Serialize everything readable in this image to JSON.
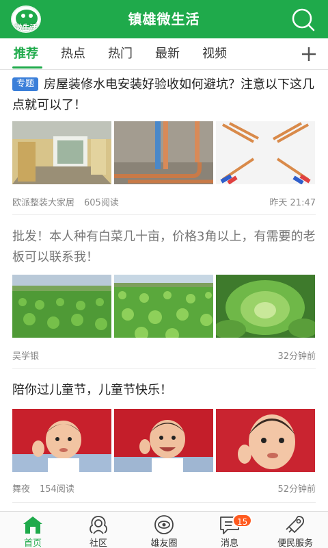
{
  "header": {
    "title": "镇雄微生活",
    "logo_text": "微生活",
    "accent": "#1faa4b"
  },
  "tabs": [
    {
      "label": "推荐",
      "active": true
    },
    {
      "label": "热点"
    },
    {
      "label": "热门"
    },
    {
      "label": "最新"
    },
    {
      "label": "视频"
    }
  ],
  "posts": [
    {
      "tag": "专题",
      "title": "房屋装修水电安装好验收如何避坑？注意以下这几点就可以了！",
      "author": "欧派整装大家居",
      "reads": "605阅读",
      "time": "昨天 21:47",
      "images": [
        "unfinished-room",
        "wall-pipes",
        "copper-wires"
      ]
    },
    {
      "title": "批发！本人种有白菜几十亩，价格3角以上，有需要的老板可以联系我！",
      "author": "吴学银",
      "time": "32分钟前",
      "images": [
        "cabbage-field-wide",
        "cabbage-rows",
        "cabbage-closeup"
      ]
    },
    {
      "title": "陪你过儿童节，儿童节快乐！",
      "author": "舞夜",
      "reads": "154阅读",
      "time": "52分钟前",
      "images": [
        "child-waving",
        "child-smiling",
        "child-closeup"
      ]
    }
  ],
  "bottom_nav": [
    {
      "label": "首页",
      "icon": "home-icon",
      "active": true
    },
    {
      "label": "社区",
      "icon": "community-icon"
    },
    {
      "label": "雄友圈",
      "icon": "circle-icon"
    },
    {
      "label": "消息",
      "icon": "message-icon",
      "badge": "15"
    },
    {
      "label": "便民服务",
      "icon": "service-icon"
    }
  ]
}
